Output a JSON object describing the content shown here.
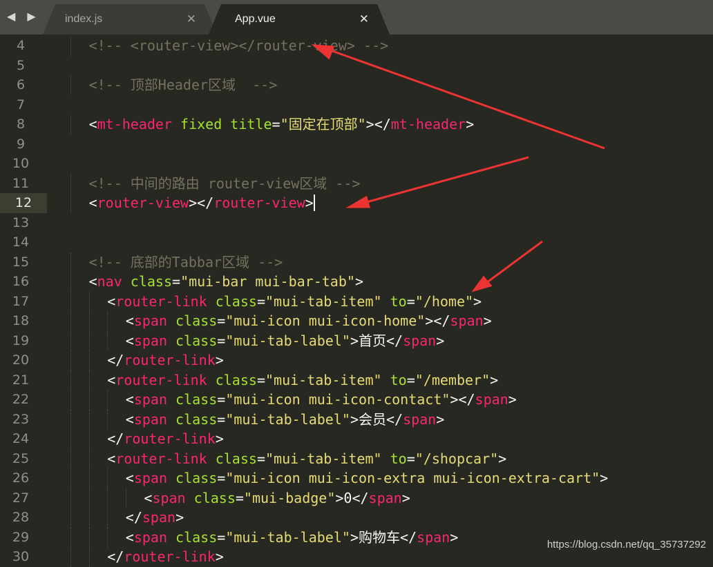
{
  "tabs": {
    "nav_arrows": "◀ ▶",
    "inactive": {
      "label": "index.js",
      "close": "✕"
    },
    "active": {
      "label": "App.vue",
      "close": "✕"
    }
  },
  "editor": {
    "current_line": "12",
    "lines": [
      {
        "n": "4",
        "indent": 1,
        "tokens": [
          {
            "t": "<!-- <router-view></router-view> -->",
            "c": "cmt"
          }
        ]
      },
      {
        "n": "5",
        "indent": 0,
        "tokens": []
      },
      {
        "n": "6",
        "indent": 1,
        "tokens": [
          {
            "t": "<!-- 顶部Header区域  -->",
            "c": "cmt"
          }
        ]
      },
      {
        "n": "7",
        "indent": 0,
        "tokens": []
      },
      {
        "n": "8",
        "indent": 1,
        "tokens": [
          {
            "t": "<",
            "c": "pun"
          },
          {
            "t": "mt-header",
            "c": "tag"
          },
          {
            "t": " fixed title",
            "c": "attr"
          },
          {
            "t": "=",
            "c": "pun"
          },
          {
            "t": "\"固定在顶部\"",
            "c": "str"
          },
          {
            "t": "></",
            "c": "pun"
          },
          {
            "t": "mt-header",
            "c": "tag"
          },
          {
            "t": ">",
            "c": "pun"
          }
        ]
      },
      {
        "n": "9",
        "indent": 0,
        "tokens": []
      },
      {
        "n": "10",
        "indent": 0,
        "tokens": []
      },
      {
        "n": "11",
        "indent": 1,
        "tokens": [
          {
            "t": "<!-- 中间的路由 router-view区域 -->",
            "c": "cmt"
          }
        ]
      },
      {
        "n": "12",
        "indent": 1,
        "caret": true,
        "tokens": [
          {
            "t": "<",
            "c": "pun"
          },
          {
            "t": "router-view",
            "c": "tag"
          },
          {
            "t": "></",
            "c": "pun"
          },
          {
            "t": "router-view",
            "c": "tag"
          },
          {
            "t": ">",
            "c": "pun"
          }
        ]
      },
      {
        "n": "13",
        "indent": 0,
        "tokens": []
      },
      {
        "n": "14",
        "indent": 0,
        "tokens": []
      },
      {
        "n": "15",
        "indent": 1,
        "tokens": [
          {
            "t": "<!-- 底部的Tabbar区域 -->",
            "c": "cmt"
          }
        ]
      },
      {
        "n": "16",
        "indent": 1,
        "tokens": [
          {
            "t": "<",
            "c": "pun"
          },
          {
            "t": "nav",
            "c": "tag"
          },
          {
            "t": " class",
            "c": "attr"
          },
          {
            "t": "=",
            "c": "pun"
          },
          {
            "t": "\"mui-bar mui-bar-tab\"",
            "c": "str"
          },
          {
            "t": ">",
            "c": "pun"
          }
        ]
      },
      {
        "n": "17",
        "indent": 2,
        "tokens": [
          {
            "t": "<",
            "c": "pun"
          },
          {
            "t": "router-link",
            "c": "tag"
          },
          {
            "t": " class",
            "c": "attr"
          },
          {
            "t": "=",
            "c": "pun"
          },
          {
            "t": "\"mui-tab-item\"",
            "c": "str"
          },
          {
            "t": " to",
            "c": "attr"
          },
          {
            "t": "=",
            "c": "pun"
          },
          {
            "t": "\"/home\"",
            "c": "str"
          },
          {
            "t": ">",
            "c": "pun"
          }
        ]
      },
      {
        "n": "18",
        "indent": 3,
        "tokens": [
          {
            "t": "<",
            "c": "pun"
          },
          {
            "t": "span",
            "c": "tag"
          },
          {
            "t": " class",
            "c": "attr"
          },
          {
            "t": "=",
            "c": "pun"
          },
          {
            "t": "\"mui-icon mui-icon-home\"",
            "c": "str"
          },
          {
            "t": "></",
            "c": "pun"
          },
          {
            "t": "span",
            "c": "tag"
          },
          {
            "t": ">",
            "c": "pun"
          }
        ]
      },
      {
        "n": "19",
        "indent": 3,
        "tokens": [
          {
            "t": "<",
            "c": "pun"
          },
          {
            "t": "span",
            "c": "tag"
          },
          {
            "t": " class",
            "c": "attr"
          },
          {
            "t": "=",
            "c": "pun"
          },
          {
            "t": "\"mui-tab-label\"",
            "c": "str"
          },
          {
            "t": ">首页</",
            "c": "pun"
          },
          {
            "t": "span",
            "c": "tag"
          },
          {
            "t": ">",
            "c": "pun"
          }
        ]
      },
      {
        "n": "20",
        "indent": 2,
        "tokens": [
          {
            "t": "</",
            "c": "pun"
          },
          {
            "t": "router-link",
            "c": "tag"
          },
          {
            "t": ">",
            "c": "pun"
          }
        ]
      },
      {
        "n": "21",
        "indent": 2,
        "tokens": [
          {
            "t": "<",
            "c": "pun"
          },
          {
            "t": "router-link",
            "c": "tag"
          },
          {
            "t": " class",
            "c": "attr"
          },
          {
            "t": "=",
            "c": "pun"
          },
          {
            "t": "\"mui-tab-item\"",
            "c": "str"
          },
          {
            "t": " to",
            "c": "attr"
          },
          {
            "t": "=",
            "c": "pun"
          },
          {
            "t": "\"/member\"",
            "c": "str"
          },
          {
            "t": ">",
            "c": "pun"
          }
        ]
      },
      {
        "n": "22",
        "indent": 3,
        "tokens": [
          {
            "t": "<",
            "c": "pun"
          },
          {
            "t": "span",
            "c": "tag"
          },
          {
            "t": " class",
            "c": "attr"
          },
          {
            "t": "=",
            "c": "pun"
          },
          {
            "t": "\"mui-icon mui-icon-contact\"",
            "c": "str"
          },
          {
            "t": "></",
            "c": "pun"
          },
          {
            "t": "span",
            "c": "tag"
          },
          {
            "t": ">",
            "c": "pun"
          }
        ]
      },
      {
        "n": "23",
        "indent": 3,
        "tokens": [
          {
            "t": "<",
            "c": "pun"
          },
          {
            "t": "span",
            "c": "tag"
          },
          {
            "t": " class",
            "c": "attr"
          },
          {
            "t": "=",
            "c": "pun"
          },
          {
            "t": "\"mui-tab-label\"",
            "c": "str"
          },
          {
            "t": ">会员</",
            "c": "pun"
          },
          {
            "t": "span",
            "c": "tag"
          },
          {
            "t": ">",
            "c": "pun"
          }
        ]
      },
      {
        "n": "24",
        "indent": 2,
        "tokens": [
          {
            "t": "</",
            "c": "pun"
          },
          {
            "t": "router-link",
            "c": "tag"
          },
          {
            "t": ">",
            "c": "pun"
          }
        ]
      },
      {
        "n": "25",
        "indent": 2,
        "tokens": [
          {
            "t": "<",
            "c": "pun"
          },
          {
            "t": "router-link",
            "c": "tag"
          },
          {
            "t": " class",
            "c": "attr"
          },
          {
            "t": "=",
            "c": "pun"
          },
          {
            "t": "\"mui-tab-item\"",
            "c": "str"
          },
          {
            "t": " to",
            "c": "attr"
          },
          {
            "t": "=",
            "c": "pun"
          },
          {
            "t": "\"/shopcar\"",
            "c": "str"
          },
          {
            "t": ">",
            "c": "pun"
          }
        ]
      },
      {
        "n": "26",
        "indent": 3,
        "tokens": [
          {
            "t": "<",
            "c": "pun"
          },
          {
            "t": "span",
            "c": "tag"
          },
          {
            "t": " class",
            "c": "attr"
          },
          {
            "t": "=",
            "c": "pun"
          },
          {
            "t": "\"mui-icon mui-icon-extra mui-icon-extra-cart\"",
            "c": "str"
          },
          {
            "t": ">",
            "c": "pun"
          }
        ]
      },
      {
        "n": "27",
        "indent": 4,
        "tokens": [
          {
            "t": "<",
            "c": "pun"
          },
          {
            "t": "span",
            "c": "tag"
          },
          {
            "t": " class",
            "c": "attr"
          },
          {
            "t": "=",
            "c": "pun"
          },
          {
            "t": "\"mui-badge\"",
            "c": "str"
          },
          {
            "t": ">0</",
            "c": "pun"
          },
          {
            "t": "span",
            "c": "tag"
          },
          {
            "t": ">",
            "c": "pun"
          }
        ]
      },
      {
        "n": "28",
        "indent": 3,
        "tokens": [
          {
            "t": "</",
            "c": "pun"
          },
          {
            "t": "span",
            "c": "tag"
          },
          {
            "t": ">",
            "c": "pun"
          }
        ]
      },
      {
        "n": "29",
        "indent": 3,
        "tokens": [
          {
            "t": "<",
            "c": "pun"
          },
          {
            "t": "span",
            "c": "tag"
          },
          {
            "t": " class",
            "c": "attr"
          },
          {
            "t": "=",
            "c": "pun"
          },
          {
            "t": "\"mui-tab-label\"",
            "c": "str"
          },
          {
            "t": ">购物车</",
            "c": "pun"
          },
          {
            "t": "span",
            "c": "tag"
          },
          {
            "t": ">",
            "c": "pun"
          }
        ]
      },
      {
        "n": "30",
        "indent": 2,
        "tokens": [
          {
            "t": "</",
            "c": "pun"
          },
          {
            "t": "router-link",
            "c": "tag"
          },
          {
            "t": ">",
            "c": "pun"
          }
        ]
      }
    ]
  },
  "watermark": "https://blog.csdn.net/qq_35737292",
  "colors": {
    "background": "#272822",
    "tag": "#f92672",
    "attribute": "#a6e22e",
    "string": "#e6db74",
    "comment": "#75715e",
    "annotation_arrow": "#ee3333"
  }
}
